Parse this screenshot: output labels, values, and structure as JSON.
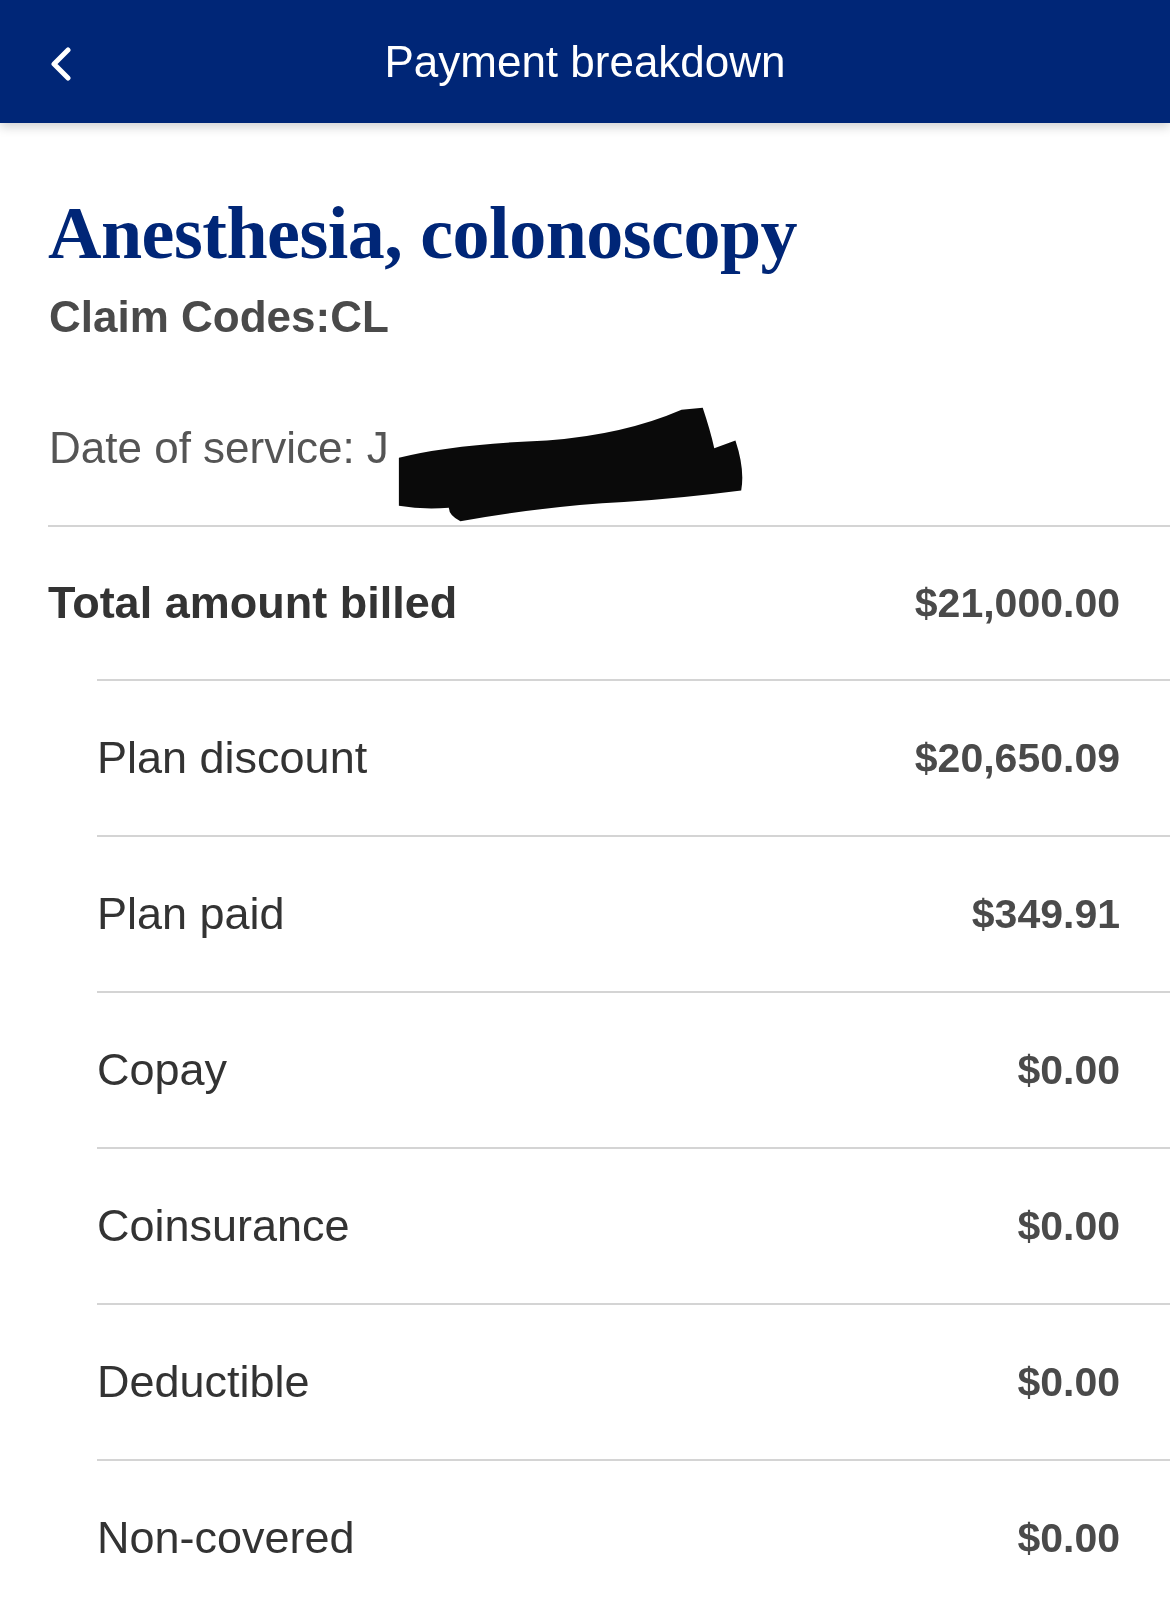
{
  "header": {
    "title": "Payment breakdown"
  },
  "claim": {
    "title": "Anesthesia, colonoscopy",
    "claim_codes": "Claim Codes:CL",
    "date_of_service": {
      "label": "Date of service:",
      "value": "J",
      "redacted": true
    }
  },
  "breakdown": [
    {
      "kind": "total",
      "label": "Total amount billed",
      "amount": "$21,000.00"
    },
    {
      "kind": "item",
      "label": "Plan discount",
      "amount": "$20,650.09"
    },
    {
      "kind": "item",
      "label": "Plan paid",
      "amount": "$349.91"
    },
    {
      "kind": "item",
      "label": "Copay",
      "amount": "$0.00"
    },
    {
      "kind": "item",
      "label": "Coinsurance",
      "amount": "$0.00"
    },
    {
      "kind": "item",
      "label": "Deductible",
      "amount": "$0.00"
    },
    {
      "kind": "item",
      "label": "Non-covered",
      "amount": "$0.00"
    }
  ]
}
